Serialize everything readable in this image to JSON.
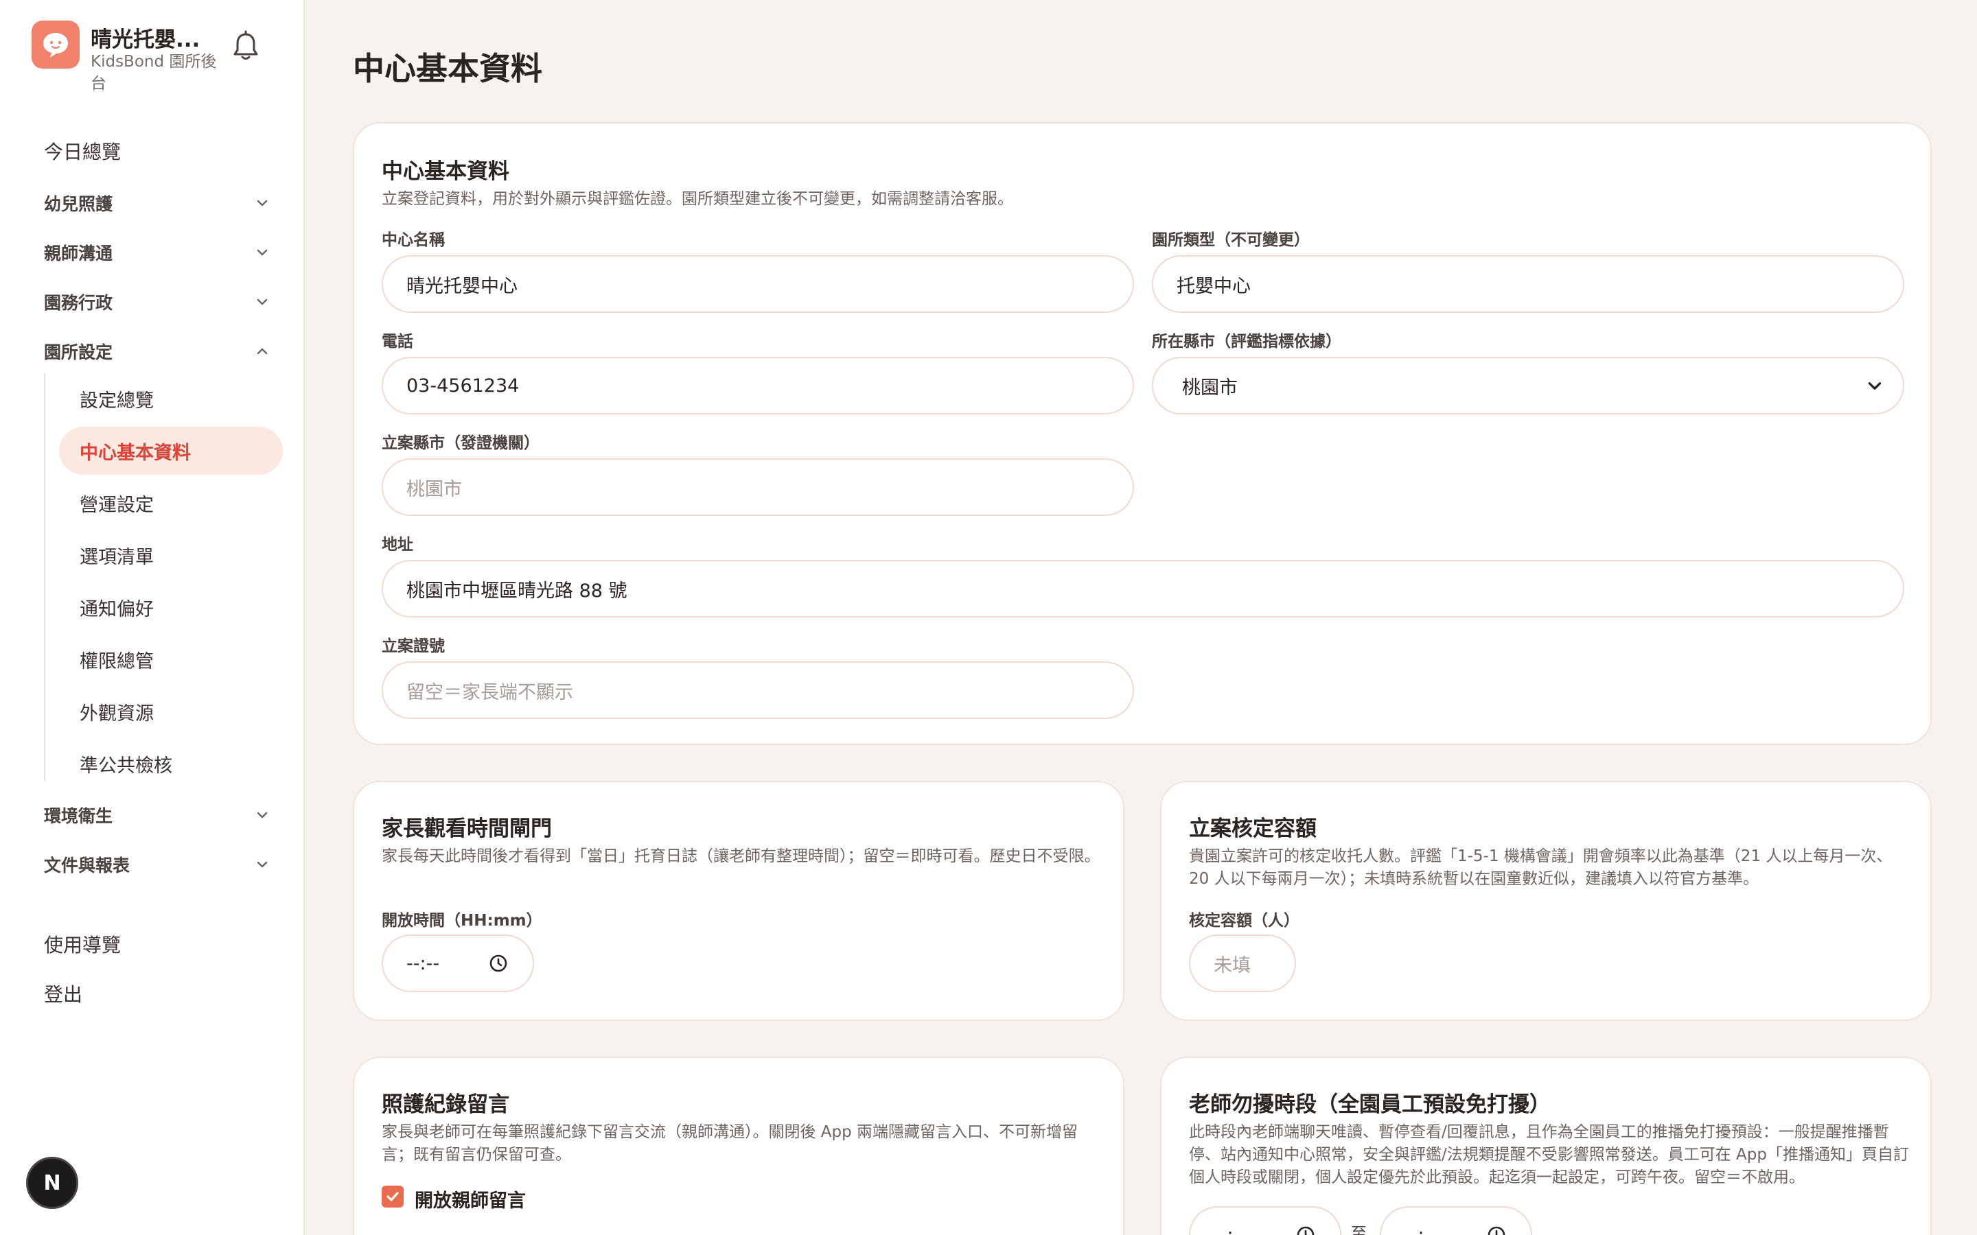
{
  "app": {
    "name": "晴光托嬰...",
    "subtitle": "KidsBond 園所後台",
    "accent": "#f0826b",
    "active_color": "#d9453a"
  },
  "sidebar": {
    "items": [
      {
        "label": "今日總覽"
      },
      {
        "label": "幼兒照護"
      },
      {
        "label": "親師溝通"
      },
      {
        "label": "園務行政"
      },
      {
        "label": "園所設定"
      }
    ],
    "sub_items": [
      {
        "label": "設定總覽"
      },
      {
        "label": "中心基本資料"
      },
      {
        "label": "營運設定"
      },
      {
        "label": "選項清單"
      },
      {
        "label": "通知偏好"
      },
      {
        "label": "權限總管"
      },
      {
        "label": "外觀資源"
      },
      {
        "label": "準公共檢核"
      }
    ],
    "after_items": [
      {
        "label": "環境衛生"
      },
      {
        "label": "文件與報表"
      }
    ],
    "bottom_items": [
      {
        "label": "使用導覽"
      },
      {
        "label": "登出"
      }
    ],
    "badge": "N"
  },
  "page": {
    "title": "中心基本資料"
  },
  "basic": {
    "title": "中心基本資料",
    "desc": "立案登記資料，用於對外顯示與評鑑佐證。園所類型建立後不可變更，如需調整請洽客服。",
    "name_label": "中心名稱",
    "name_value": "晴光托嬰中心",
    "type_label": "園所類型（不可變更）",
    "type_value": "托嬰中心",
    "phone_label": "電話",
    "phone_value": "03-4561234",
    "county_label": "所在縣市（評鑑指標依據）",
    "county_value": "桃園市",
    "reg_county_label": "立案縣市（發證機關）",
    "reg_county_placeholder": "桃園市",
    "address_label": "地址",
    "address_value": "桃園市中壢區晴光路 88 號",
    "cert_label": "立案證號",
    "cert_placeholder": "留空＝家長端不顯示"
  },
  "parent_gate": {
    "title": "家長觀看時間閘門",
    "desc": "家長每天此時間後才看得到「當日」托育日誌（讓老師有整理時間）；留空＝即時可看。歷史日不受限。",
    "label": "開放時間（HH:mm）",
    "value": "--:--"
  },
  "capacity": {
    "title": "立案核定容額",
    "desc": "貴園立案許可的核定收托人數。評鑑「1-5-1 機構會議」開會頻率以此為基準（21 人以上每月一次、20 人以下每兩月一次）；未填時系統暫以在園童數近似，建議填入以符官方基準。",
    "label": "核定容額（人）",
    "placeholder": "未填"
  },
  "comments": {
    "title": "照護紀錄留言",
    "desc": "家長與老師可在每筆照護紀錄下留言交流（親師溝通）。關閉後 App 兩端隱藏留言入口、不可新增留言；既有留言仍保留可查。",
    "checkbox_label": "開放親師留言"
  },
  "dnd": {
    "title": "老師勿擾時段（全園員工預設免打擾）",
    "desc": "此時段內老師端聊天唯讀、暫停查看/回覆訊息，且作為全園員工的推播免打擾預設：一般提醒推播暫停、站內通知中心照常，安全與評鑑/法規類提醒不受影響照常發送。員工可在 App「推播通知」頁自訂個人時段或關閉，個人設定優先於此預設。起迄須一起設定，可跨午夜。留空＝不啟用。",
    "from_value": "--:--",
    "separator": "至",
    "to_value": "--:--"
  }
}
